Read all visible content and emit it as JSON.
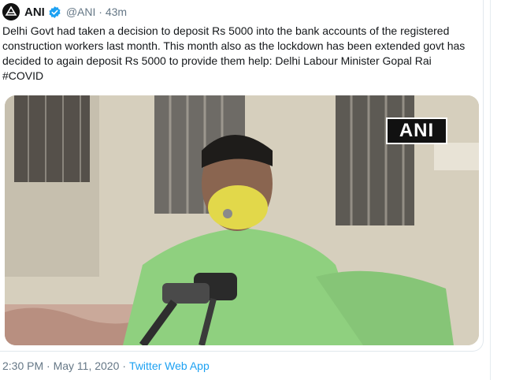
{
  "tweet": {
    "author_name": "ANI",
    "handle": "@ANI",
    "separator": "·",
    "age": "43m",
    "text": "Delhi Govt had taken a decision to deposit Rs 5000 into the bank accounts of the registered construction workers last month. This month also as the lockdown has been extended govt has decided to again deposit Rs 5000 to provide them help: Delhi Labour Minister Gopal Rai #COVID",
    "media_watermark": "ANI",
    "timestamp": "2:30 PM · May 11, 2020",
    "meta_separator": "·",
    "source_app": "Twitter Web App"
  },
  "colors": {
    "verified_badge": "#1da1f2",
    "secondary_text": "#657786",
    "link": "#1da1f2"
  },
  "icons": {
    "avatar": "ani-logo-avatar",
    "verified": "verified-badge-icon"
  }
}
